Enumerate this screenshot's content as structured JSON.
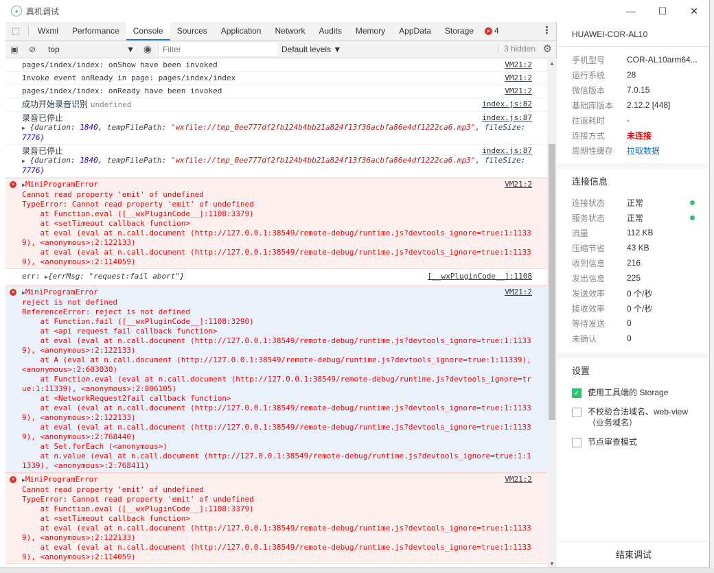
{
  "window": {
    "title": "真机调试",
    "min": "—",
    "max": "☐",
    "close": "✕"
  },
  "tabs": {
    "items": [
      "Wxml",
      "Performance",
      "Console",
      "Sources",
      "Application",
      "Network",
      "Audits",
      "Memory",
      "AppData",
      "Storage"
    ],
    "active": "Console",
    "error_count": "4",
    "more": "⋮"
  },
  "filterbar": {
    "context": "top",
    "filter_placeholder": "Filter",
    "levels": "Default levels ▼",
    "hidden": "3 hidden"
  },
  "console": {
    "m1": {
      "text": "pages/index/index: onShow have been invoked",
      "src": "VM21:2"
    },
    "m2": {
      "text": "Invoke event onReady in page: pages/index/index",
      "src": "VM21:2"
    },
    "m3": {
      "text": "pages/index/index: onReady have been invoked",
      "src": "VM21:2"
    },
    "m4": {
      "text": "成功开始录音识别",
      "extra": "undefined",
      "src": "index.js:82"
    },
    "m5": {
      "text": "录音已停止",
      "src": "index.js:87",
      "duration": "1840",
      "path": "\"wxfile://tmp_0ee777df2fb124b4bb21a824f13f36acbfa86e4df1222ca6.mp3\"",
      "size": "7776"
    },
    "m6": {
      "text": "录音已停止",
      "src": "index.js:87",
      "duration": "1840",
      "path": "\"wxfile://tmp_0ee777df2fb124b4bb21a824f13f36acbfa86e4df1222ca6.mp3\"",
      "size": "7776"
    },
    "e1": {
      "src": "VM21:2",
      "lines": [
        "MiniProgramError",
        "Cannot read property 'emit' of undefined",
        "TypeError: Cannot read property 'emit' of undefined",
        "    at Function.eval ([__wxPluginCode__]:1108:3379)",
        "    at <setTimeout callback function>",
        "    at eval (eval at n.call.document (http://127.0.0.1:38549/remote-debug/runtime.js?devtools_ignore=true:1:1133",
        "9), <anonymous>:2:122133)",
        "    at eval (eval at n.call.document (http://127.0.0.1:38549/remote-debug/runtime.js?devtools_ignore=true:1:1133",
        "9), <anonymous>:2:114059)"
      ]
    },
    "m7": {
      "label": "err:",
      "obj": "{errMsg: \"request:fail abort\"}",
      "src": "[__wxPluginCode__]:1108"
    },
    "e2": {
      "src": "VM21:2",
      "lines": [
        "MiniProgramError",
        "reject is not defined",
        "ReferenceError: reject is not defined",
        "    at Function.fail ([__wxPluginCode__]:1108:3290)",
        "    at <api request fail callback function>",
        "    at eval (eval at n.call.document (http://127.0.0.1:38549/remote-debug/runtime.js?devtools_ignore=true:1:1133",
        "9), <anonymous>:2:122133)",
        "    at A (eval at n.call.document (http://127.0.0.1:38549/remote-debug/runtime.js?devtools_ignore=true:1:11339),",
        "<anonymous>:2:603030)",
        "    at Function.eval (eval at n.call.document (http://127.0.0.1:38549/remote-debug/runtime.js?devtools_ignore=tr",
        "ue:1:11339), <anonymous>:2:806105)",
        "    at <NetworkRequest2fail callback function>",
        "    at eval (eval at n.call.document (http://127.0.0.1:38549/remote-debug/runtime.js?devtools_ignore=true:1:1133",
        "9), <anonymous>:2:122133)",
        "    at eval (eval at n.call.document (http://127.0.0.1:38549/remote-debug/runtime.js?devtools_ignore=true:1:1133",
        "9), <anonymous>:2:768440)",
        "    at Set.forEach (<anonymous>)",
        "    at n.value (eval at n.call.document (http://127.0.0.1:38549/remote-debug/runtime.js?devtools_ignore=true:1:1",
        "1339), <anonymous>:2:768411)"
      ]
    },
    "e3": {
      "src": "VM21:2",
      "lines": [
        "MiniProgramError",
        "Cannot read property 'emit' of undefined",
        "TypeError: Cannot read property 'emit' of undefined",
        "    at Function.eval ([__wxPluginCode__]:1108:3379)",
        "    at <setTimeout callback function>",
        "    at eval (eval at n.call.document (http://127.0.0.1:38549/remote-debug/runtime.js?devtools_ignore=true:1:1133",
        "9), <anonymous>:2:122133)",
        "    at eval (eval at n.call.document (http://127.0.0.1:38549/remote-debug/runtime.js?devtools_ignore=true:1:1133",
        "9), <anonymous>:2:114059)"
      ]
    }
  },
  "panel": {
    "device": "HUAWEI-COR-AL10",
    "info": [
      {
        "k": "手机型号",
        "v": "COR-AL10arm64..."
      },
      {
        "k": "运行系统",
        "v": "28"
      },
      {
        "k": "微信版本",
        "v": "7.0.15"
      },
      {
        "k": "基础库版本",
        "v": "2.12.2 [448]"
      },
      {
        "k": "往返耗时",
        "v": "-"
      },
      {
        "k": "连接方式",
        "v": "未连接"
      },
      {
        "k": "周期性缓存",
        "v": "拉取数据"
      }
    ],
    "conn_title": "连接信息",
    "conn": [
      {
        "k": "连接状态",
        "v": "正常"
      },
      {
        "k": "服务状态",
        "v": "正常"
      },
      {
        "k": "流量",
        "v": "112 KB"
      },
      {
        "k": "压缩节省",
        "v": "43 KB"
      },
      {
        "k": "收到信息",
        "v": "216"
      },
      {
        "k": "发出信息",
        "v": "225"
      },
      {
        "k": "发送效率",
        "v": "0 个/秒"
      },
      {
        "k": "接收效率",
        "v": "0 个/秒"
      },
      {
        "k": "等待发送",
        "v": "0"
      },
      {
        "k": "未确认",
        "v": "0"
      }
    ],
    "settings_title": "设置",
    "settings": [
      {
        "label": "使用工具端的 Storage",
        "checked": true
      },
      {
        "label": "不校验合法域名、web-view（业务域名）",
        "checked": false
      },
      {
        "label": "节点审查模式",
        "checked": false
      }
    ],
    "end_button": "结束调试"
  }
}
